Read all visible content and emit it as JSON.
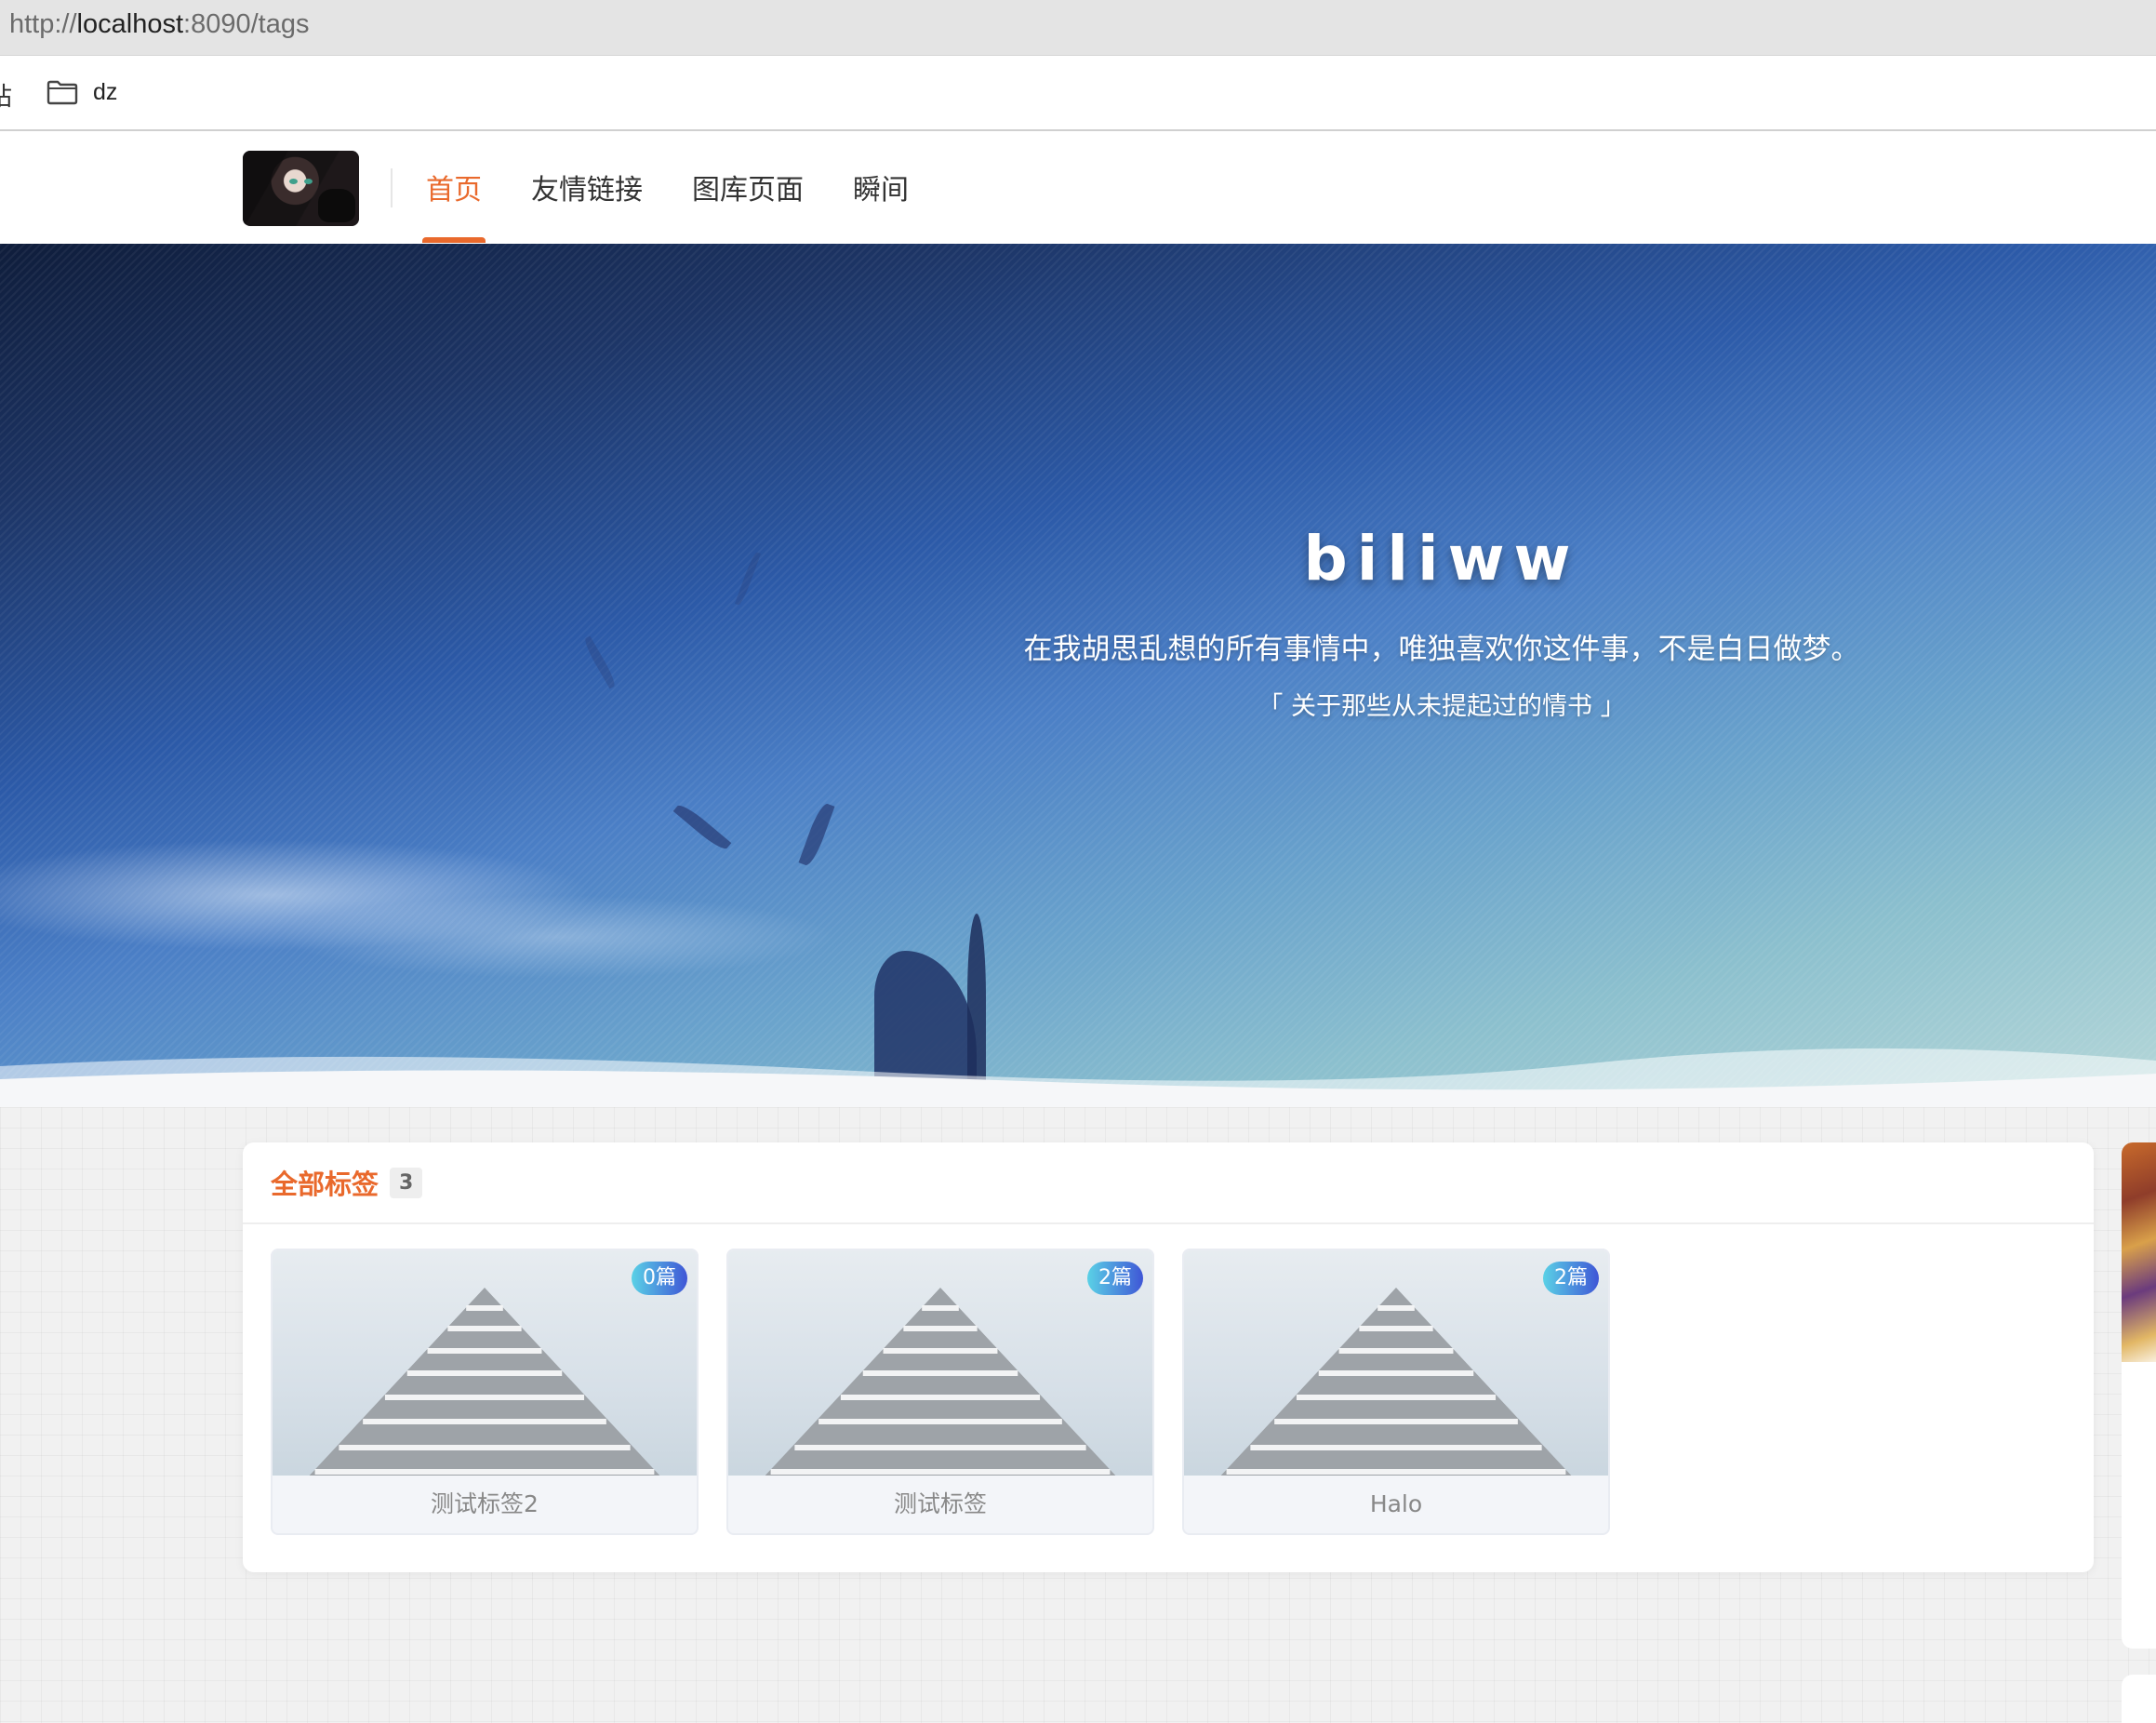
{
  "browser": {
    "url_scheme": "http://",
    "url_host": "localhost",
    "url_rest": ":8090/tags"
  },
  "bookmarks": {
    "cut_label": "站",
    "folder_label": "dz",
    "folder_icon": "folder-icon"
  },
  "header": {
    "logo": "avatar-logo",
    "nav": [
      {
        "label": "首页",
        "active": true
      },
      {
        "label": "友情链接",
        "active": false
      },
      {
        "label": "图库页面",
        "active": false
      },
      {
        "label": "瞬间",
        "active": false
      }
    ],
    "accent_color": "#e9692c"
  },
  "hero": {
    "title": "biliww",
    "subtitle": "在我胡思乱想的所有事情中，唯独喜欢你这件事，不是白日做梦。",
    "quote": "「 关于那些从未提起过的情书 」"
  },
  "tags_section": {
    "title": "全部标签",
    "count": "3",
    "items": [
      {
        "name": "测试标签2",
        "posts": "0篇"
      },
      {
        "name": "测试标签",
        "posts": "2篇"
      },
      {
        "name": "Halo",
        "posts": "2篇"
      }
    ]
  }
}
